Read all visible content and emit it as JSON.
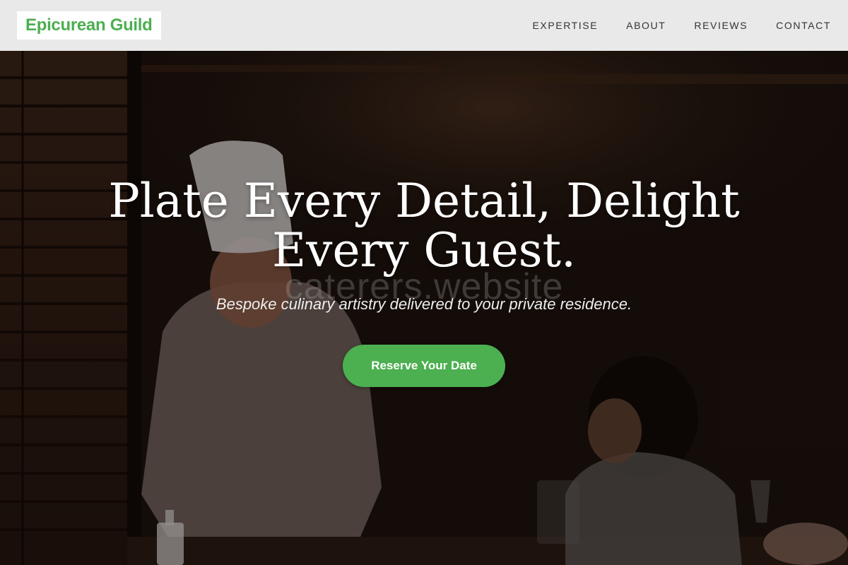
{
  "brand": {
    "name": "Epicurean Guild"
  },
  "nav": {
    "items": [
      {
        "label": "EXPERTISE"
      },
      {
        "label": "ABOUT"
      },
      {
        "label": "REVIEWS"
      },
      {
        "label": "CONTACT"
      }
    ]
  },
  "hero": {
    "title": "Plate Every Detail, Delight Every Guest.",
    "watermark": "caterers.website",
    "subtitle": "Bespoke culinary artistry delivered to your private residence.",
    "cta_label": "Reserve Your Date",
    "background_image": "chef-serving-diner-photo"
  },
  "colors": {
    "accent": "#4caf50",
    "navbar_bg": "#e9e9e9",
    "nav_text": "#333333",
    "hero_text": "#ffffff"
  }
}
